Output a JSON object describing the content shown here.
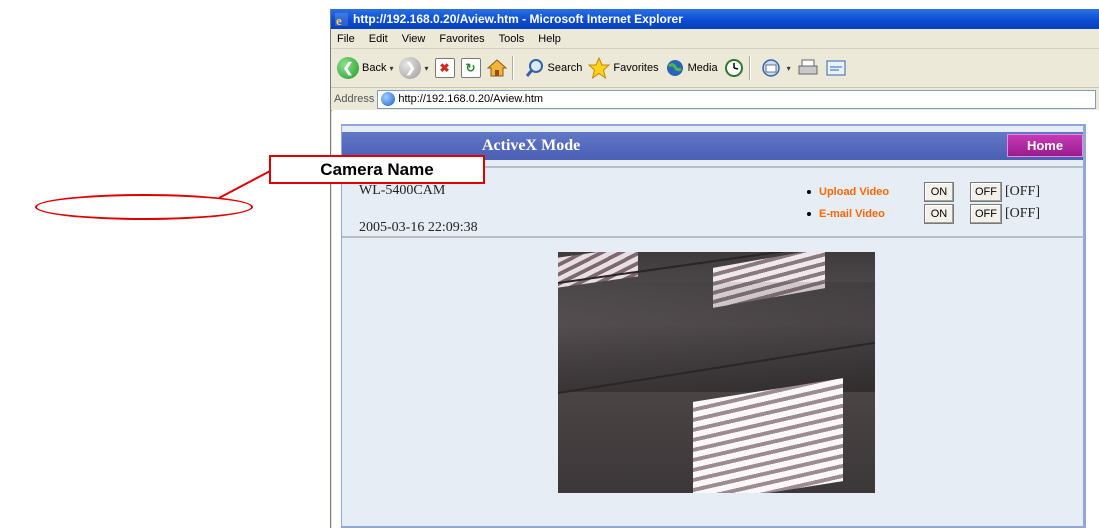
{
  "window": {
    "title": "http://192.168.0.20/Aview.htm - Microsoft Internet Explorer"
  },
  "menu": [
    "File",
    "Edit",
    "View",
    "Favorites",
    "Tools",
    "Help"
  ],
  "toolbar": {
    "back": "Back",
    "search": "Search",
    "favorites": "Favorites",
    "media": "Media"
  },
  "address": {
    "label": "Address",
    "url": "http://192.168.0.20/Aview.htm"
  },
  "page": {
    "mode_title": "ActiveX Mode",
    "home_label": "Home",
    "camera_name": "WL-5400CAM",
    "timestamp": "2005-03-16 22:09:38",
    "controls": [
      {
        "label": "Upload Video",
        "on": "ON",
        "off": "OFF",
        "state": "[OFF]"
      },
      {
        "label": "E-mail Video",
        "on": "ON",
        "off": "OFF",
        "state": "[OFF]"
      }
    ]
  },
  "callout": {
    "label": "Camera Name",
    "color": "#e00000"
  }
}
